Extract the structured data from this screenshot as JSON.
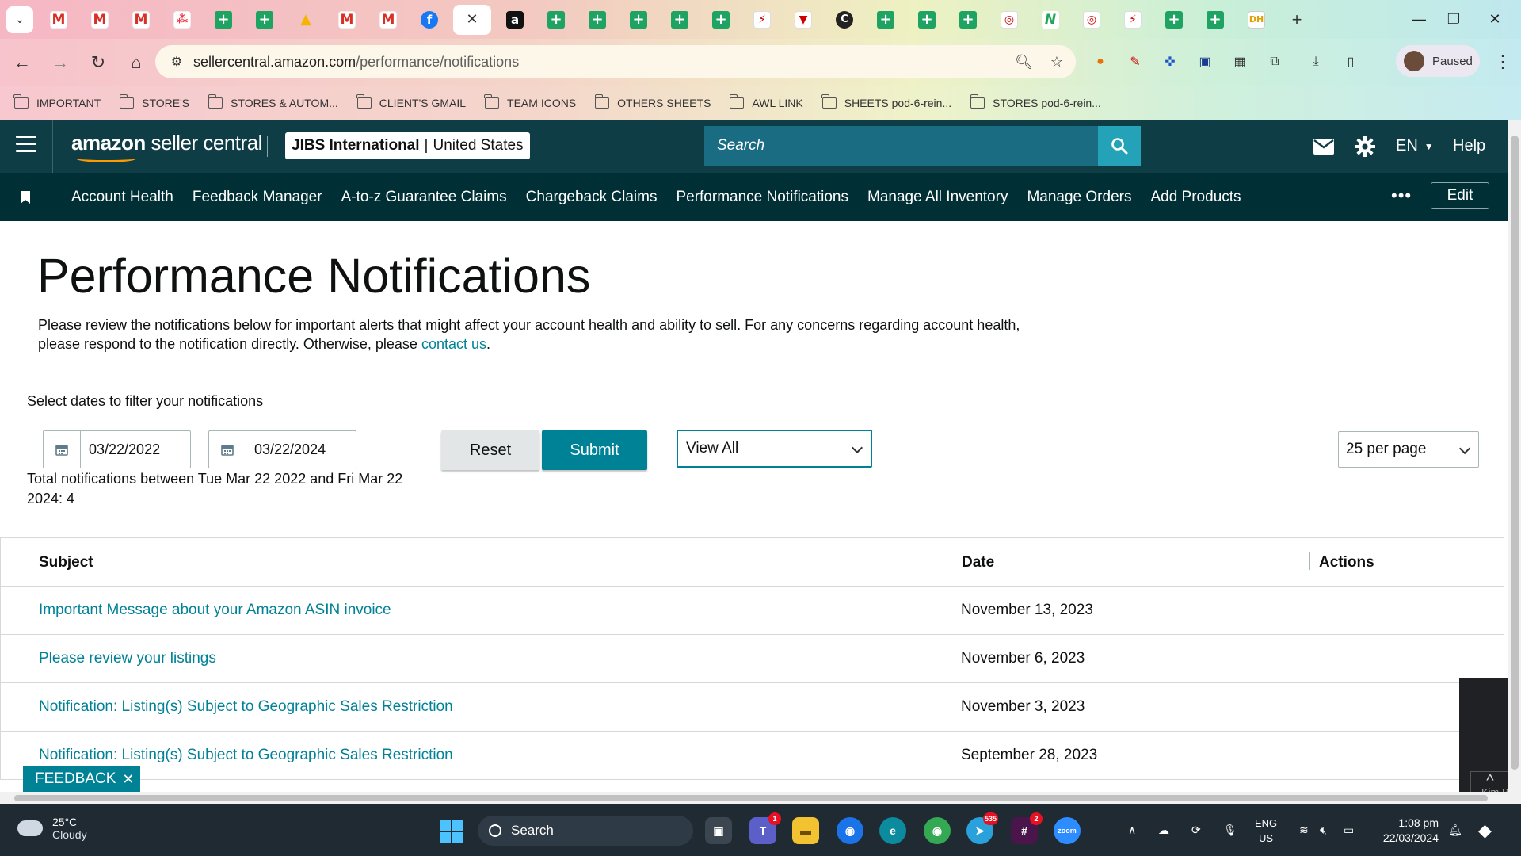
{
  "browser": {
    "tabs": [
      {
        "icon": "gmail-icon",
        "glyph": "M"
      },
      {
        "icon": "gmail-icon",
        "glyph": "M"
      },
      {
        "icon": "gmail-icon",
        "glyph": "M"
      },
      {
        "icon": "app-dots-icon",
        "glyph": "⁂"
      },
      {
        "icon": "sheets-icon",
        "glyph": "+"
      },
      {
        "icon": "sheets-icon",
        "glyph": "+"
      },
      {
        "icon": "drive-icon",
        "glyph": "▲"
      },
      {
        "icon": "gmail-icon",
        "glyph": "M"
      },
      {
        "icon": "gmail-icon",
        "glyph": "M"
      },
      {
        "icon": "facebook-icon",
        "glyph": "f"
      },
      {
        "icon": "close-icon",
        "glyph": "✕"
      },
      {
        "icon": "amazon-icon",
        "glyph": "a"
      },
      {
        "icon": "sheets-icon",
        "glyph": "+"
      },
      {
        "icon": "sheets-icon",
        "glyph": "+"
      },
      {
        "icon": "sheets-icon",
        "glyph": "+"
      },
      {
        "icon": "sheets-icon",
        "glyph": "+"
      },
      {
        "icon": "sheets-icon",
        "glyph": "+"
      },
      {
        "icon": "zap-icon",
        "glyph": "⚡"
      },
      {
        "icon": "shield-icon",
        "glyph": "▼"
      },
      {
        "icon": "c-icon",
        "glyph": "C"
      },
      {
        "icon": "sheets-icon",
        "glyph": "+"
      },
      {
        "icon": "sheets-icon",
        "glyph": "+"
      },
      {
        "icon": "sheets-icon",
        "glyph": "+"
      },
      {
        "icon": "badge-icon",
        "glyph": "◎"
      },
      {
        "icon": "n-icon",
        "glyph": "N"
      },
      {
        "icon": "badge-icon",
        "glyph": "◎"
      },
      {
        "icon": "zap-icon",
        "glyph": "⚡"
      },
      {
        "icon": "sheets-icon",
        "glyph": "+"
      },
      {
        "icon": "sheets-icon",
        "glyph": "+"
      },
      {
        "icon": "dh-icon",
        "glyph": "DH"
      }
    ],
    "url_host": "sellercentral.amazon.com",
    "url_path": "/performance/notifications",
    "profile_label": "Paused",
    "bookmarks": [
      "IMPORTANT",
      "STORE'S",
      "STORES & AUTOM...",
      "CLIENT'S GMAIL",
      "TEAM ICONS",
      "OTHERS SHEETS",
      "AWL LINK",
      "SHEETS pod-6-rein...",
      "STORES pod-6-rein..."
    ]
  },
  "header": {
    "logo_bold": "amazon",
    "logo_rest": " seller central",
    "account_name": "JIBS International",
    "account_sep": "|",
    "account_region": "United States",
    "search_placeholder": "Search",
    "language": "EN",
    "help": "Help"
  },
  "nav": {
    "links": [
      "Account Health",
      "Feedback Manager",
      "A-to-z Guarantee Claims",
      "Chargeback Claims",
      "Performance Notifications",
      "Manage All Inventory",
      "Manage Orders",
      "Add Products"
    ],
    "more": "•••",
    "edit": "Edit"
  },
  "main": {
    "title": "Performance Notifications",
    "intro_text": "Please review the notifications below for important alerts that might affect your account health and ability to sell. For any concerns regarding account health, please respond to the notification directly. Otherwise, please ",
    "intro_link": "contact us",
    "intro_end": ".",
    "filter_label": "Select dates to filter your notifications",
    "date_from": "03/22/2022",
    "date_to": "03/22/2024",
    "reset": "Reset",
    "submit": "Submit",
    "view_filter": "View All",
    "per_page": "25 per page",
    "total_text": "Total notifications between Tue Mar 22 2022 and Fri Mar 22 2024: 4"
  },
  "table": {
    "headers": {
      "subject": "Subject",
      "date": "Date",
      "actions": "Actions"
    },
    "rows": [
      {
        "subject": "Important Message about your Amazon ASIN invoice",
        "date": "November 13, 2023"
      },
      {
        "subject": "Please review your listings",
        "date": "November 6, 2023"
      },
      {
        "subject": "Notification: Listing(s) Subject to Geographic Sales Restriction",
        "date": "November 3, 2023"
      },
      {
        "subject": "Notification: Listing(s) Subject to Geographic Sales Restriction",
        "date": "September 28, 2023"
      }
    ]
  },
  "feedback": {
    "label": "FEEDBACK",
    "close": "✕"
  },
  "side_panel": {
    "name": "Kim Bo"
  },
  "taskbar": {
    "temp": "25°C",
    "condition": "Cloudy",
    "search": "Search",
    "telegram_badge": "535",
    "teams_badge": "1",
    "slack_badge": "2",
    "lang_1": "ENG",
    "lang_2": "US",
    "time": "1:08 pm",
    "date": "22/03/2024",
    "zoom_label": "zoom"
  },
  "colors": {
    "amazon_header": "#0f3d46",
    "amazon_nav": "#002f36",
    "accent_teal": "#008296",
    "search_bg": "#1a6c82",
    "search_button": "#23a2b8"
  }
}
